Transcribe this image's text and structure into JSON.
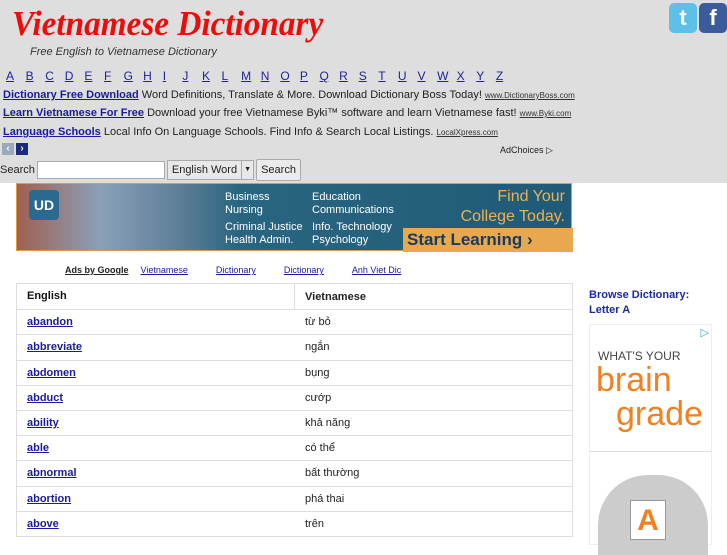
{
  "header": {
    "title": "Vietnamese Dictionary",
    "subtitle": "Free English to Vietnamese Dictionary",
    "social": [
      "twitter",
      "facebook"
    ]
  },
  "letters": [
    "A",
    "B",
    "C",
    "D",
    "E",
    "F",
    "G",
    "H",
    "I",
    "J",
    "K",
    "L",
    "M",
    "N",
    "O",
    "P",
    "Q",
    "R",
    "S",
    "T",
    "U",
    "V",
    "W",
    "X",
    "Y",
    "Z"
  ],
  "text_ads": [
    {
      "link": "Dictionary Free Download",
      "text": "Word Definitions, Translate & More. Download Dictionary Boss Today!",
      "url": "www.DictionaryBoss.com"
    },
    {
      "link": "Learn Vietnamese For Free",
      "text": "Download your free Vietnamese Byki™ software and learn Vietnamese fast!",
      "url": "www.Byki.com"
    },
    {
      "link": "Language Schools",
      "text": "Local Info On Language Schools. Find Info & Search Local Listings.",
      "url": "LocalXpress.com"
    }
  ],
  "adchoices": "AdChoices",
  "search": {
    "label": "Search",
    "value": "",
    "select": "English Word",
    "button": "Search"
  },
  "banner": {
    "logo": "UD",
    "col1": [
      "Business",
      "Nursing",
      "Criminal Justice",
      "Health Admin."
    ],
    "col2": [
      "Education",
      "Communications",
      "Info. Technology",
      "Psychology"
    ],
    "headline": "Find Your College Today.",
    "cta": "Start Learning ›"
  },
  "ads_by": {
    "label": "Ads by Google",
    "links": [
      "Vietnamese",
      "Dictionary",
      "Dictionary",
      "Anh Viet Dic"
    ]
  },
  "table": {
    "headers": [
      "English",
      "Vietnamese"
    ],
    "rows": [
      [
        "abandon",
        "từ bỏ"
      ],
      [
        "abbreviate",
        "ngắn"
      ],
      [
        "abdomen",
        "bụng"
      ],
      [
        "abduct",
        "cướp"
      ],
      [
        "ability",
        "khả năng"
      ],
      [
        "able",
        "có thể"
      ],
      [
        "abnormal",
        "bất thường"
      ],
      [
        "abortion",
        "phá thai"
      ],
      [
        "above",
        "trên"
      ]
    ]
  },
  "sidebar": {
    "browse": "Browse Dictionary:",
    "letter": "Letter A",
    "ad": {
      "line1": "WHAT'S YOUR",
      "line2": "brain",
      "line3": "grade",
      "badge": "A"
    }
  }
}
